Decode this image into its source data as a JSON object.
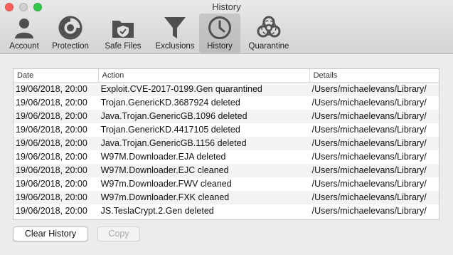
{
  "window": {
    "title": "History"
  },
  "tabs": [
    {
      "label": "Account",
      "icon": "account-icon"
    },
    {
      "label": "Protection",
      "icon": "protection-icon"
    },
    {
      "label": "Safe Files",
      "icon": "safe-files-icon"
    },
    {
      "label": "Exclusions",
      "icon": "funnel-icon"
    },
    {
      "label": "History",
      "icon": "clock-icon",
      "active": true
    },
    {
      "label": "Quarantine",
      "icon": "biohazard-icon"
    }
  ],
  "table": {
    "columns": [
      "Date",
      "Action",
      "Details"
    ],
    "rows": [
      {
        "date": "19/06/2018, 20:00",
        "action": "Exploit.CVE-2017-0199.Gen quarantined",
        "details": "/Users/michaelevans/Library/"
      },
      {
        "date": "19/06/2018, 20:00",
        "action": "Trojan.GenericKD.3687924 deleted",
        "details": "/Users/michaelevans/Library/"
      },
      {
        "date": "19/06/2018, 20:00",
        "action": "Java.Trojan.GenericGB.1096 deleted",
        "details": "/Users/michaelevans/Library/"
      },
      {
        "date": "19/06/2018, 20:00",
        "action": "Trojan.GenericKD.4417105 deleted",
        "details": "/Users/michaelevans/Library/"
      },
      {
        "date": "19/06/2018, 20:00",
        "action": "Java.Trojan.GenericGB.1156 deleted",
        "details": "/Users/michaelevans/Library/"
      },
      {
        "date": "19/06/2018, 20:00",
        "action": "W97M.Downloader.EJA deleted",
        "details": "/Users/michaelevans/Library/"
      },
      {
        "date": "19/06/2018, 20:00",
        "action": "W97M.Downloader.EJC cleaned",
        "details": "/Users/michaelevans/Library/"
      },
      {
        "date": "19/06/2018, 20:00",
        "action": "W97m.Downloader.FWV cleaned",
        "details": "/Users/michaelevans/Library/"
      },
      {
        "date": "19/06/2018, 20:00",
        "action": "W97m.Downloader.FXK cleaned",
        "details": "/Users/michaelevans/Library/"
      },
      {
        "date": "19/06/2018, 20:00",
        "action": "JS.TeslaCrypt.2.Gen deleted",
        "details": "/Users/michaelevans/Library/"
      }
    ]
  },
  "buttons": {
    "clear_label": "Clear History",
    "copy_label": "Copy"
  },
  "colors": {
    "close": "#fc605c",
    "minimize": "#cfcfcf",
    "maximize": "#34c84a",
    "icon": "#555555"
  }
}
